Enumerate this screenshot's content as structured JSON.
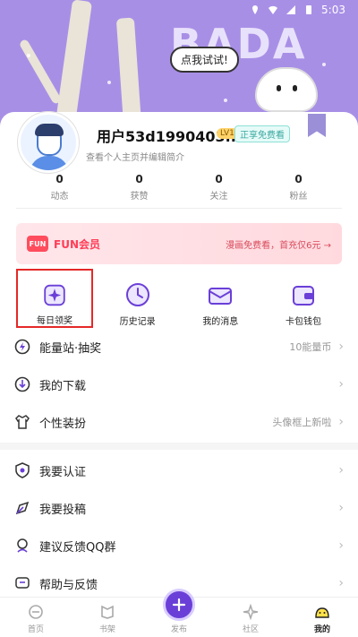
{
  "status_bar": {
    "time": "5:03"
  },
  "banner": {
    "logo_text": "BADA",
    "bubble_text": "点我试试!"
  },
  "profile": {
    "username": "用户53d1990403...",
    "level_badge": "LV1",
    "free_badge": "正享免费看",
    "edit_hint": "查看个人主页并编辑简介",
    "stats": [
      {
        "value": "0",
        "label": "动态"
      },
      {
        "value": "0",
        "label": "获赞"
      },
      {
        "value": "0",
        "label": "关注"
      },
      {
        "value": "0",
        "label": "粉丝"
      }
    ]
  },
  "fun_member": {
    "logo": "FUN",
    "title": "FUN会员",
    "promo": "漫画免费看，首充仅6元 →"
  },
  "quick_actions": [
    {
      "label": "每日领奖",
      "icon": "sparkle-icon"
    },
    {
      "label": "历史记录",
      "icon": "clock-icon"
    },
    {
      "label": "我的消息",
      "icon": "envelope-icon"
    },
    {
      "label": "卡包钱包",
      "icon": "wallet-icon"
    }
  ],
  "menu_group_1": [
    {
      "label": "能量站·抽奖",
      "value": "10能量币",
      "icon": "energy-icon"
    },
    {
      "label": "我的下载",
      "value": "",
      "icon": "download-icon"
    },
    {
      "label": "个性装扮",
      "value": "头像框上新啦",
      "icon": "shirt-icon"
    }
  ],
  "menu_group_2": [
    {
      "label": "我要认证",
      "value": "",
      "icon": "verify-icon"
    },
    {
      "label": "我要投稿",
      "value": "",
      "icon": "submit-icon"
    },
    {
      "label": "建议反馈QQ群",
      "value": "",
      "icon": "feedback-icon"
    },
    {
      "label": "帮助与反馈",
      "value": "",
      "icon": "help-icon"
    }
  ],
  "bottom_nav": [
    {
      "label": "首页",
      "icon": "home-icon"
    },
    {
      "label": "书架",
      "icon": "bookshelf-icon"
    },
    {
      "label": "发布",
      "icon": "publish-icon"
    },
    {
      "label": "社区",
      "icon": "community-icon"
    },
    {
      "label": "我的",
      "icon": "profile-icon"
    }
  ],
  "colors": {
    "banner_bg": "#a88fe6",
    "accent_purple": "#6a3fd7",
    "fun_red": "#ff3d57",
    "highlight_box": "#e52828"
  }
}
